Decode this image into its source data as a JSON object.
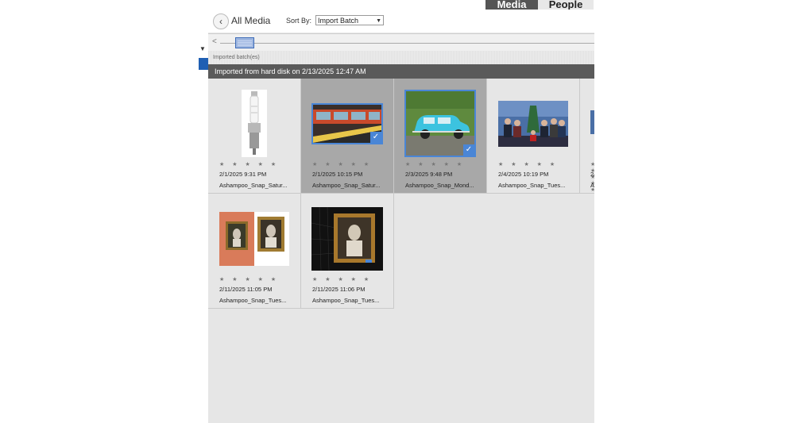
{
  "top_tabs": {
    "media": "Media",
    "people": "People"
  },
  "header": {
    "back_label": "All Media",
    "sort_label": "Sort By:",
    "sort_value": "Import Batch"
  },
  "timeline": {
    "left_arrow": "<",
    "caption": "Imported batch(es)"
  },
  "batch_title": "Imported from hard disk on 2/13/2025 12:47 AM",
  "stars_glyph": "★ ★ ★ ★ ★",
  "items": [
    {
      "date": "2/1/2025 9:31 PM",
      "name": "Ashampoo_Snap_Satur...",
      "selected": false
    },
    {
      "date": "2/1/2025 10:15 PM",
      "name": "Ashampoo_Snap_Satur...",
      "selected": true
    },
    {
      "date": "2/3/2025 9:48 PM",
      "name": "Ashampoo_Snap_Mond...",
      "selected": true
    },
    {
      "date": "2/4/2025 10:19 PM",
      "name": "Ashampoo_Snap_Tues...",
      "selected": false
    },
    {
      "date": "2/",
      "name": "As",
      "selected": false
    },
    {
      "date": "2/11/2025 11:05 PM",
      "name": "Ashampoo_Snap_Tues...",
      "selected": false
    },
    {
      "date": "2/11/2025 11:06 PM",
      "name": "Ashampoo_Snap_Tues...",
      "selected": false
    }
  ],
  "colors": {
    "accent": "#4a86d6",
    "batch_bar": "#5a5a5a",
    "selected_cell": "#a8a8a8"
  }
}
